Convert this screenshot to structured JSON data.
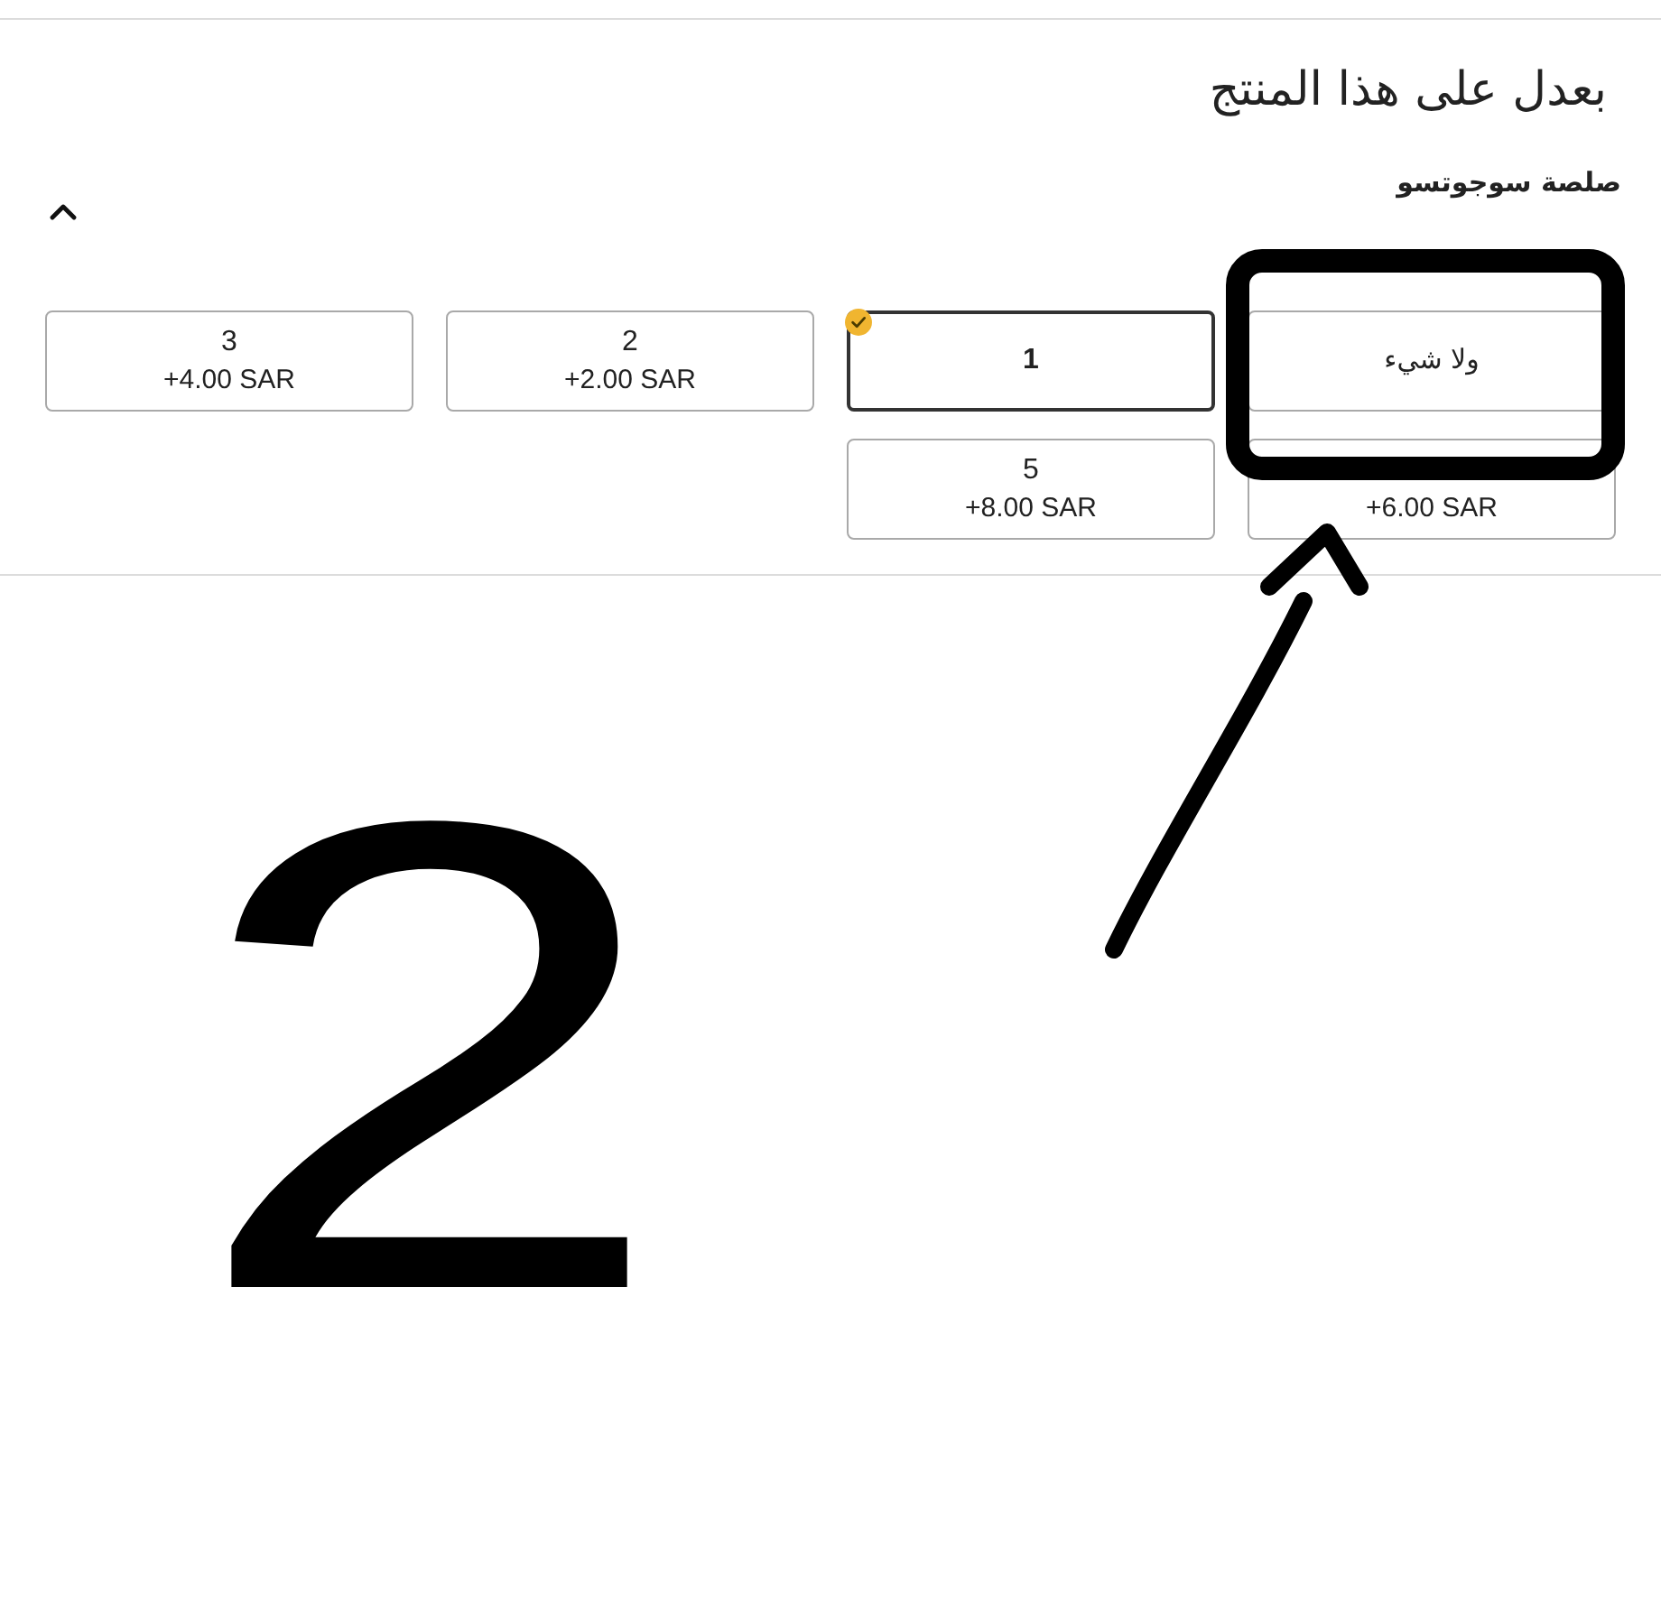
{
  "header": {
    "title": "بعدل على هذا المنتج"
  },
  "section": {
    "title": "صلصة سوجوتسو",
    "expanded": true,
    "options": [
      {
        "label": "ولا شيء",
        "selected": false
      },
      {
        "label": "1",
        "selected": true
      },
      {
        "label": "2",
        "price": "+2.00 SAR",
        "selected": false
      },
      {
        "label": "3",
        "price": "+4.00 SAR",
        "selected": false
      },
      {
        "price": "+6.00 SAR",
        "selected": false
      },
      {
        "label": "5",
        "price": "+8.00 SAR",
        "selected": false
      }
    ]
  },
  "annotations": [
    {
      "kind": "rectangle"
    },
    {
      "kind": "arrow"
    },
    {
      "kind": "number",
      "text": "2"
    }
  ]
}
